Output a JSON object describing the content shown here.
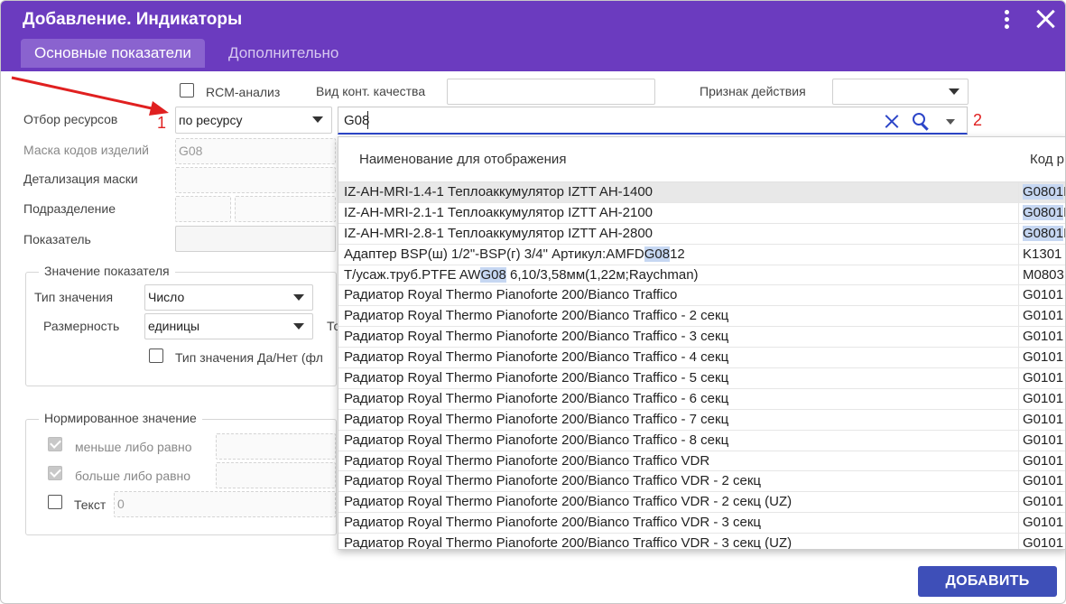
{
  "dialog": {
    "title": "Добавление. Индикаторы",
    "tabs": [
      {
        "label": "Основные показатели",
        "active": true
      },
      {
        "label": "Дополнительно",
        "active": false
      }
    ]
  },
  "form": {
    "rcm_label": "RCM-анализ",
    "rcm_checked": false,
    "quality_label": "Вид конт. качества",
    "quality_value": "",
    "action_label": "Признак действия",
    "action_value": "",
    "resource_label": "Отбор ресурсов",
    "resource_value": "по ресурсу",
    "search_value": "G08",
    "mask_label": "Маска кодов изделий",
    "mask_value": "G08",
    "mask_detail_label": "Детализация маски",
    "department_label": "Подразделение",
    "indicator_label": "Показатель"
  },
  "value_group": {
    "legend": "Значение показателя",
    "type_label": "Тип значения",
    "type_value": "Число",
    "unit_label": "Размерность",
    "unit_value": "единицы",
    "truncated_label": "То",
    "yesno_label": "Тип значения Да/Нет (фл",
    "yesno_checked": false
  },
  "norm_group": {
    "legend": "Нормированное значение",
    "le_label": "меньше либо равно",
    "le_checked": true,
    "ge_label": "больше либо равно",
    "ge_checked": true,
    "text_label": "Текст",
    "text_checked": false,
    "text_value": "0"
  },
  "dropdown": {
    "col_name": "Наименование для отображения",
    "col_code": "Код р",
    "rows": [
      {
        "pre": "IZ-AH-MRI-1.4-1 Теплоаккумулятор IZTT AH-1400",
        "hl": "",
        "post": "",
        "code_hl": "G0801",
        "code_rest": "I",
        "selected": true
      },
      {
        "pre": "IZ-AH-MRI-2.1-1 Теплоаккумулятор IZTT AH-2100",
        "hl": "",
        "post": "",
        "code_hl": "G0801",
        "code_rest": "I",
        "selected": false
      },
      {
        "pre": "IZ-AH-MRI-2.8-1 Теплоаккумулятор IZTT AH-2800",
        "hl": "",
        "post": "",
        "code_hl": "G0801",
        "code_rest": "I",
        "selected": false
      },
      {
        "pre": "Адаптер BSP(ш) 1/2\"-BSP(г) 3/4\" Артикул:AMFD",
        "hl": "G08",
        "post": "12",
        "code_hl": "",
        "code_rest": "K1301",
        "selected": false
      },
      {
        "pre": "Т/усаж.труб.PTFE AW",
        "hl": "G08",
        "post": " 6,10/3,58мм(1,22м;Raychman)",
        "code_hl": "",
        "code_rest": "M0803",
        "selected": false
      },
      {
        "pre": "Радиатор Royal Thermo Pianoforte 200/Bianco Traffico",
        "hl": "",
        "post": "",
        "code_hl": "",
        "code_rest": "G0101",
        "selected": false
      },
      {
        "pre": "Радиатор Royal Thermo Pianoforte 200/Bianco Traffico - 2 секц",
        "hl": "",
        "post": "",
        "code_hl": "",
        "code_rest": "G0101",
        "selected": false
      },
      {
        "pre": "Радиатор Royal Thermo Pianoforte 200/Bianco Traffico - 3 секц",
        "hl": "",
        "post": "",
        "code_hl": "",
        "code_rest": "G0101",
        "selected": false
      },
      {
        "pre": "Радиатор Royal Thermo Pianoforte 200/Bianco Traffico - 4 секц",
        "hl": "",
        "post": "",
        "code_hl": "",
        "code_rest": "G0101",
        "selected": false
      },
      {
        "pre": "Радиатор Royal Thermo Pianoforte 200/Bianco Traffico - 5 секц",
        "hl": "",
        "post": "",
        "code_hl": "",
        "code_rest": "G0101",
        "selected": false
      },
      {
        "pre": "Радиатор Royal Thermo Pianoforte 200/Bianco Traffico - 6 секц",
        "hl": "",
        "post": "",
        "code_hl": "",
        "code_rest": "G0101",
        "selected": false
      },
      {
        "pre": "Радиатор Royal Thermo Pianoforte 200/Bianco Traffico - 7 секц",
        "hl": "",
        "post": "",
        "code_hl": "",
        "code_rest": "G0101",
        "selected": false
      },
      {
        "pre": "Радиатор Royal Thermo Pianoforte 200/Bianco Traffico - 8 секц",
        "hl": "",
        "post": "",
        "code_hl": "",
        "code_rest": "G0101",
        "selected": false
      },
      {
        "pre": "Радиатор Royal Thermo Pianoforte 200/Bianco Traffico VDR",
        "hl": "",
        "post": "",
        "code_hl": "",
        "code_rest": "G0101",
        "selected": false
      },
      {
        "pre": "Радиатор Royal Thermo Pianoforte 200/Bianco Traffico VDR - 2 секц",
        "hl": "",
        "post": "",
        "code_hl": "",
        "code_rest": "G0101",
        "selected": false
      },
      {
        "pre": "Радиатор Royal Thermo Pianoforte 200/Bianco Traffico VDR - 2 секц (UZ)",
        "hl": "",
        "post": "",
        "code_hl": "",
        "code_rest": "G0101",
        "selected": false
      },
      {
        "pre": "Радиатор Royal Thermo Pianoforte 200/Bianco Traffico VDR - 3 секц",
        "hl": "",
        "post": "",
        "code_hl": "",
        "code_rest": "G0101",
        "selected": false
      },
      {
        "pre": "Радиатор Royal Thermo Pianoforte 200/Bianco Traffico VDR - 3 секц (UZ)",
        "hl": "",
        "post": "",
        "code_hl": "",
        "code_rest": "G0101",
        "selected": false
      }
    ]
  },
  "actions": {
    "add_label": "ДОБАВИТЬ"
  },
  "annotations": {
    "marker_1": "1",
    "marker_2": "2",
    "color": "#e02020"
  },
  "colors": {
    "header": "#6b3bbf",
    "accent": "#2c45c8",
    "button": "#3e4fb8"
  }
}
